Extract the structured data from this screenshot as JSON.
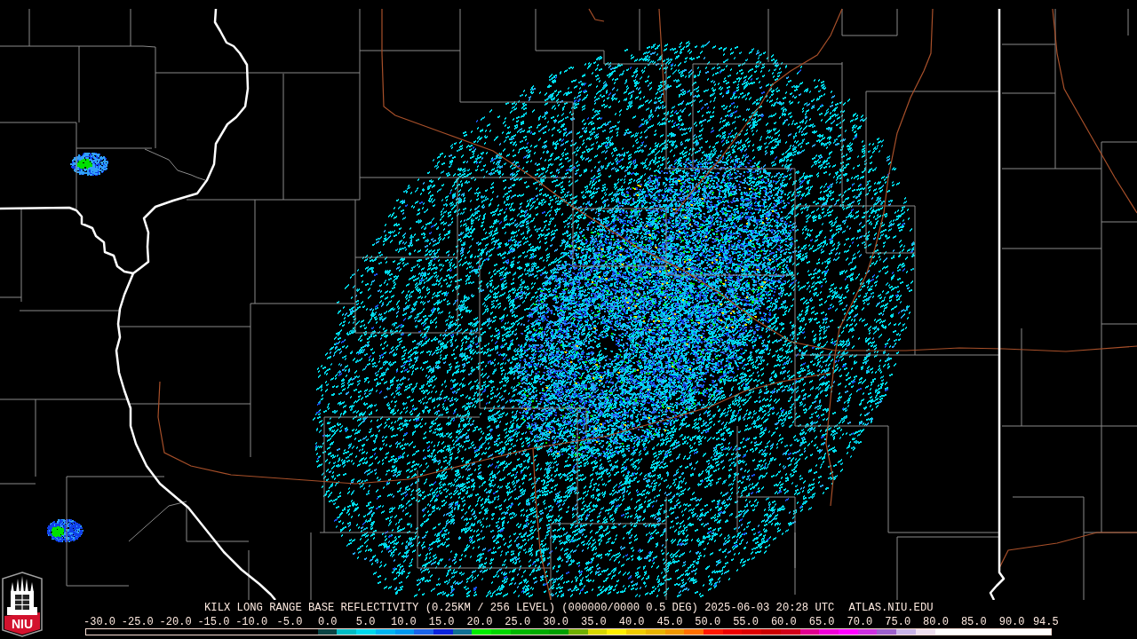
{
  "caption": {
    "title": "KILX LONG RANGE BASE REFLECTIVITY (0.25KM / 256 LEVEL) (000000/0000 0.5 DEG) 2025-06-03 20:28 UTC",
    "site": "ATLAS.NIU.EDU"
  },
  "legend": {
    "ticks": [
      "-30.0",
      "-25.0",
      "-20.0",
      "-15.0",
      "-10.0",
      "-5.0",
      "0.0",
      "5.0",
      "10.0",
      "15.0",
      "20.0",
      "25.0",
      "30.0",
      "35.0",
      "40.0",
      "45.0",
      "50.0",
      "55.0",
      "60.0",
      "65.0",
      "70.0",
      "75.0",
      "80.0",
      "85.0",
      "90.0",
      "94.5"
    ],
    "colors": [
      {
        "color": "#0a4444"
      },
      {
        "color": "#00bcc4"
      },
      {
        "color": "#00d8ec"
      },
      {
        "color": "#00b4f0"
      },
      {
        "color": "#0098ee"
      },
      {
        "color": "#1a64e8"
      },
      {
        "color": "#0a24dc"
      },
      {
        "color": "#107094"
      },
      {
        "color": "#00ee00"
      },
      {
        "color": "#00d800"
      },
      {
        "color": "#00b800"
      },
      {
        "color": "#00ac00"
      },
      {
        "color": "#00a000"
      },
      {
        "color": "#70b000"
      },
      {
        "color": "#d8d800"
      },
      {
        "color": "#fff000"
      },
      {
        "color": "#f0cc00"
      },
      {
        "color": "#e8b400"
      },
      {
        "color": "#f09800"
      },
      {
        "color": "#ff7000"
      },
      {
        "color": "#ff1800"
      },
      {
        "color": "#ee0000"
      },
      {
        "color": "#dd0000"
      },
      {
        "color": "#cc0000"
      },
      {
        "color": "#d0001a"
      },
      {
        "color": "#e00090"
      },
      {
        "color": "#f000d8"
      },
      {
        "color": "#ff00ff"
      },
      {
        "color": "#cc30e0"
      },
      {
        "color": "#9c60cc"
      },
      {
        "color": "#c8b4e8"
      },
      {
        "color": "#eee0f0"
      },
      {
        "color": "#ffffff"
      },
      {
        "color": "#ffffff"
      },
      {
        "color": "#ffffff"
      },
      {
        "color": "#ffffff"
      },
      {
        "color": "#ffffff"
      },
      {
        "color": "#ffffff"
      }
    ]
  },
  "logo": {
    "text": "NIU"
  }
}
